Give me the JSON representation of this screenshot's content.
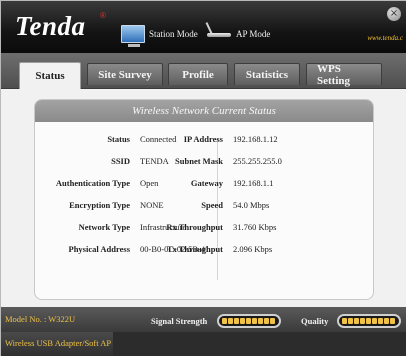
{
  "header": {
    "logo": "Tenda",
    "logo_mark": "®",
    "station_mode": "Station Mode",
    "ap_mode": "AP Mode",
    "website": "www.tenda.c",
    "close_glyph": "×"
  },
  "tabs": [
    {
      "label": "Status"
    },
    {
      "label": "Site Survey"
    },
    {
      "label": "Profile"
    },
    {
      "label": "Statistics"
    },
    {
      "label": "WPS Setting"
    }
  ],
  "panel": {
    "title": "Wireless Network Current Status",
    "left": [
      {
        "label": "Status",
        "value": "Connected"
      },
      {
        "label": "SSID",
        "value": "TENDA"
      },
      {
        "label": "Authentication Type",
        "value": "Open"
      },
      {
        "label": "Encryption Type",
        "value": "NONE"
      },
      {
        "label": "Network Type",
        "value": "Infrastructure"
      },
      {
        "label": "Physical Address",
        "value": "00-B0-0C-02-5B-41"
      }
    ],
    "right": [
      {
        "label": "IP Address",
        "value": "192.168.1.12"
      },
      {
        "label": "Subnet Mask",
        "value": "255.255.255.0"
      },
      {
        "label": "Gateway",
        "value": "192.168.1.1"
      },
      {
        "label": "Speed",
        "value": "54.0 Mbps"
      },
      {
        "label": "Rx Throughput",
        "value": "31.760 Kbps"
      },
      {
        "label": "Tx Throughput",
        "value": "2.096 Kbps"
      }
    ]
  },
  "footer": {
    "model": "Model No. : W322U",
    "adapter": "Wireless USB Adapter/Soft AP",
    "signal_label": "Signal Strength",
    "quality_label": "Quality",
    "signal_level": 1.0,
    "quality_level": 1.0
  },
  "colors": {
    "accent": "#f0c247",
    "header_bg": "#141414",
    "panel_title_bg": "#9a9a9a"
  }
}
